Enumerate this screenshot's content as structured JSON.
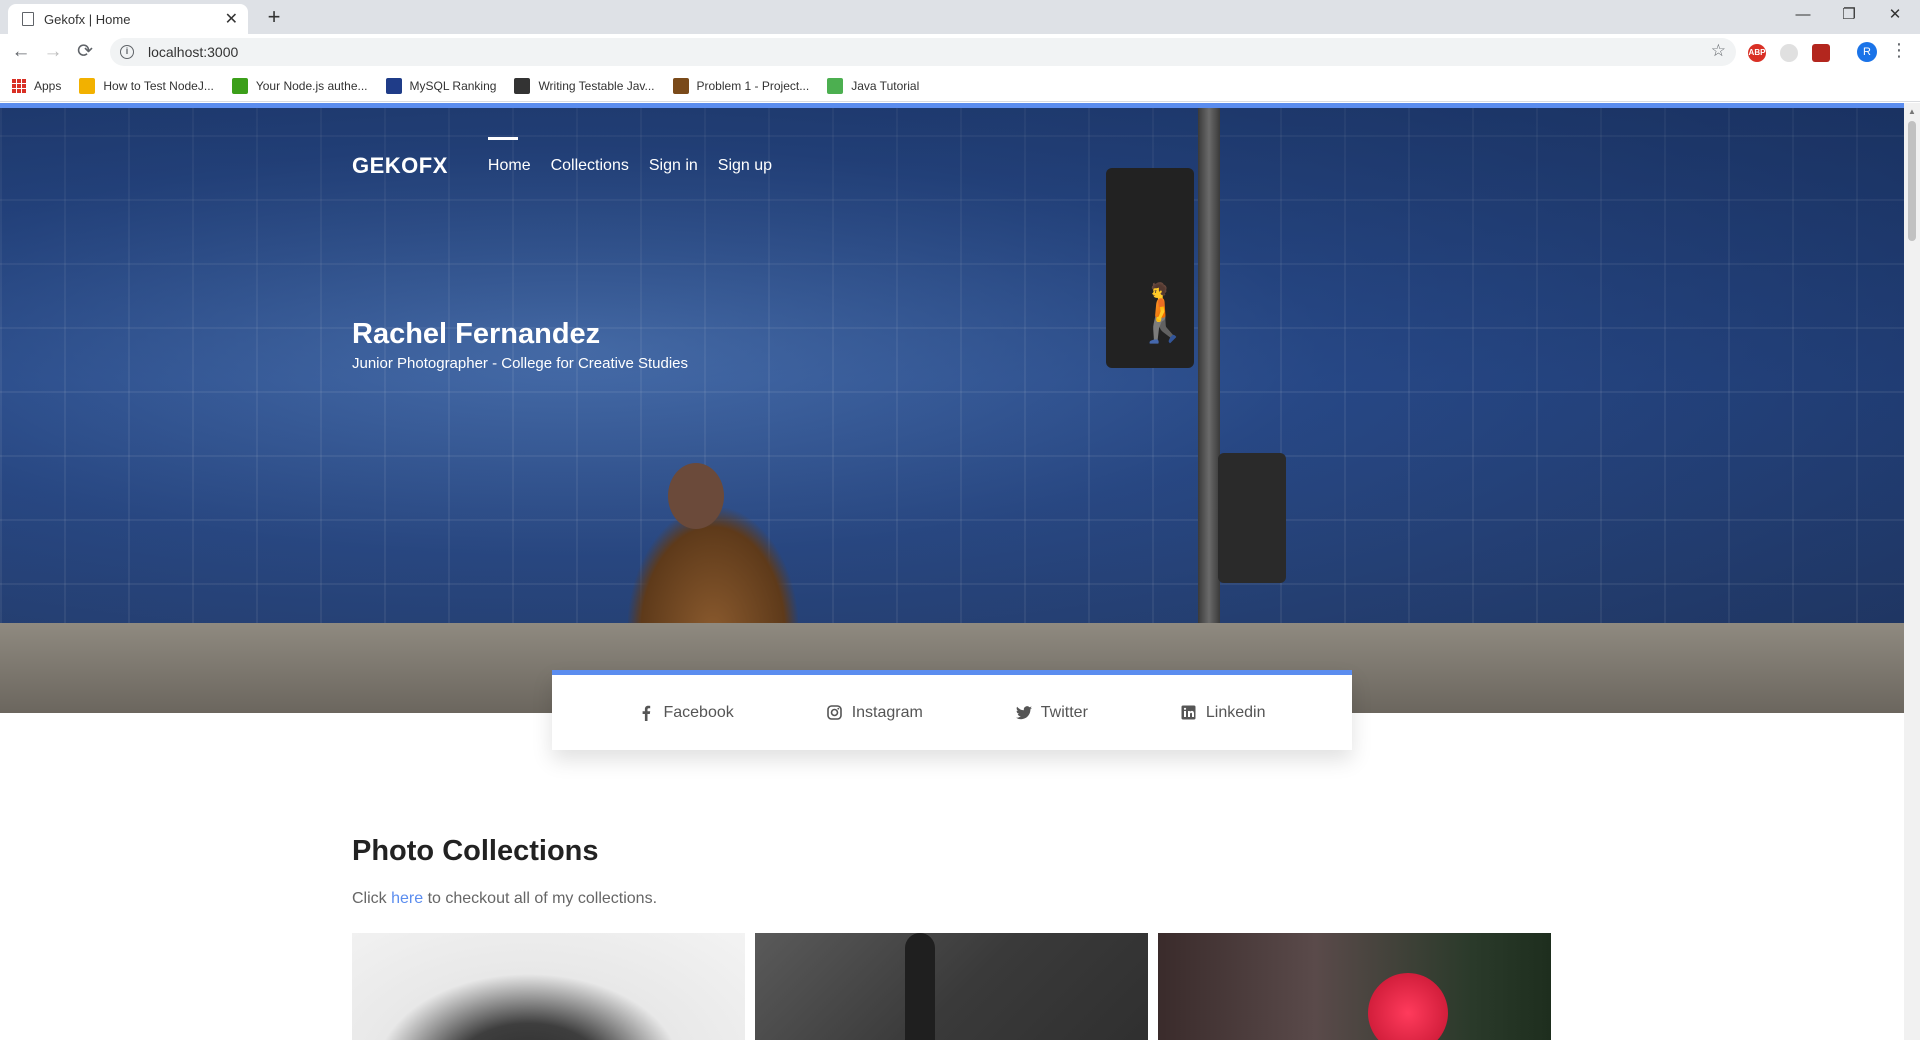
{
  "browser": {
    "tab_title": "Gekofx | Home",
    "url": "localhost:3000",
    "avatar_letter": "R",
    "bookmarks": [
      {
        "label": "Apps"
      },
      {
        "label": "How to Test NodeJ...",
        "color": "#f2b100"
      },
      {
        "label": "Your Node.js authe...",
        "color": "#3c9f1a"
      },
      {
        "label": "MySQL Ranking",
        "color": "#1f3c88"
      },
      {
        "label": "Writing Testable Jav...",
        "color": "#333333"
      },
      {
        "label": "Problem 1 - Project...",
        "color": "#7a4a1a"
      },
      {
        "label": "Java Tutorial",
        "color": "#4caf50"
      }
    ]
  },
  "site": {
    "brand": "GEKOFX",
    "nav": [
      "Home",
      "Collections",
      "Sign in",
      "Sign up"
    ],
    "hero": {
      "name": "Rachel Fernandez",
      "subtitle": "Junior Photographer - College for Creative Studies"
    },
    "social": [
      "Facebook",
      "Instagram",
      "Twitter",
      "Linkedin"
    ],
    "collections": {
      "title": "Photo Collections",
      "text_before": "Click ",
      "link": "here",
      "text_after": " to checkout all of my collections."
    }
  },
  "colors": {
    "accent": "#5b8def",
    "walk_signal": "#2ecc40"
  }
}
